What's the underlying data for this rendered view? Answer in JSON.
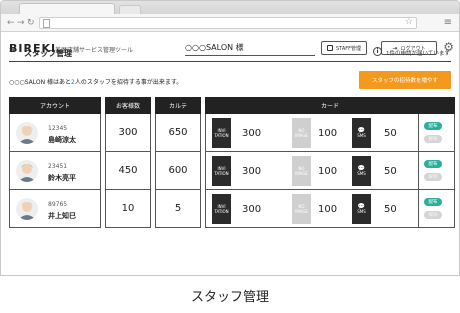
{
  "app": {
    "logo": "BIREKI",
    "tagline": "美歴店舗サービス管理ツール",
    "salon_name": "○○○SALON 様",
    "staff_btn": "STAFF管理",
    "logout_btn": "ログアウト"
  },
  "page": {
    "title": "スタッフ管理",
    "notice": "1件の申請が届いています",
    "desc_before": "○○○SALON 様はあと",
    "desc_count": "2",
    "desc_after": "人のスタッフを招待する事が出来ます。",
    "invite_btn": "スタッフの招待数を増やす",
    "caption": "スタッフ管理"
  },
  "table": {
    "headers": {
      "account": "アカウント",
      "customers": "お客様数",
      "karte": "カルテ",
      "card": "カード"
    },
    "card_labels": {
      "invitation": "INVI TATION",
      "no_image": "NO IMAGE",
      "sms": "SMS",
      "distribute": "配布",
      "cancel": "解除"
    },
    "rows": [
      {
        "id": "12345",
        "name": "島崎涼太",
        "customers": "300",
        "karte": "650",
        "invitation": "300",
        "no_image": "100",
        "sms": "50",
        "avatar_color": "#e0a15e"
      },
      {
        "id": "23451",
        "name": "鈴木亮平",
        "customers": "450",
        "karte": "600",
        "invitation": "300",
        "no_image": "100",
        "sms": "50",
        "avatar_color": "#8a6a55"
      },
      {
        "id": "89765",
        "name": "井上知巳",
        "customers": "10",
        "karte": "5",
        "invitation": "300",
        "no_image": "100",
        "sms": "50",
        "avatar_color": "#c9a27a"
      }
    ]
  },
  "icons": [
    "back-icon",
    "forward-icon",
    "reload-icon",
    "page-icon",
    "star-icon",
    "menu-icon",
    "staff-icon",
    "logout-icon",
    "gear-icon",
    "scissors-icon",
    "info-icon",
    "sms-icon"
  ]
}
